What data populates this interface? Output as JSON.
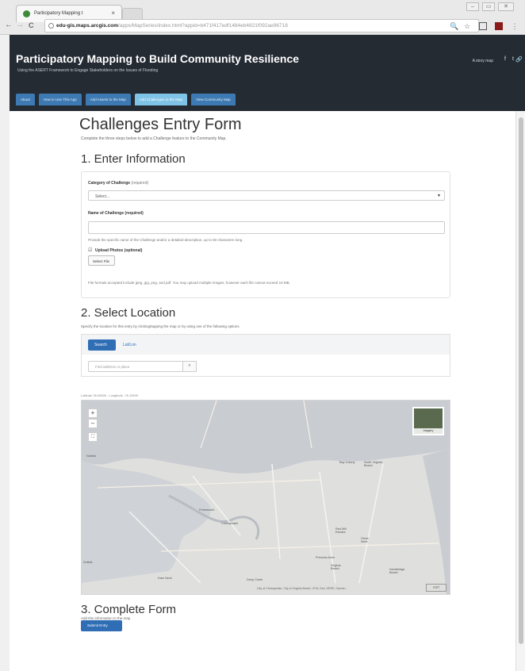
{
  "browser": {
    "tab_title": "Participatory Mapping t",
    "tab_close": "×",
    "back": "←",
    "forward": "→",
    "reload": "C",
    "url_domain": "edu-gis.maps.arcgis.com",
    "url_rest": "/apps/MapSeries/index.html?appid=b471f417edf1484eb4821f092ae96718",
    "win_min": "–",
    "win_max": "▭",
    "win_close": "✕",
    "ext_zoom": "🔍",
    "ext_star": "☆",
    "ext_menu": "⋮"
  },
  "header": {
    "title": "Participatory Mapping to Build Community Resilience",
    "subtitle": "Using the ASERT Framework to Engage Stakeholders on the Issues of Flooding",
    "story_map": "A story map",
    "social": [
      "f",
      "t",
      "🔗"
    ],
    "tabs": [
      {
        "label": "About"
      },
      {
        "label": "How to Use This App"
      },
      {
        "label": "Add Assets to the Map"
      },
      {
        "label": "Add Challenges to the Map"
      },
      {
        "label": "View Community Map"
      }
    ]
  },
  "form": {
    "heading": "Challenges Entry Form",
    "intro": "Complete the three steps below to add a Challenge feature to the Community Map.",
    "step1": "1. Enter Information",
    "category_label": "Category of Challenge",
    "category_req": "(required)",
    "category_value": "Select...",
    "name_label": "Name of Challenge (required)",
    "name_help": "Provide the specific name of the Challenge and/or a detailed description, up to 50 characters long.",
    "upload_label": "Upload Photos (optional)",
    "select_file": "Select File",
    "file_help": "File formats accepted include jpeg, jpg, png, and pdf. You may upload multiple images; however each file cannot exceed 10 MB.",
    "step2": "2. Select Location",
    "location_help": "Specify the location for this entry by clicking/tapping the map or by using one of the following options",
    "search_tab": "Search",
    "latlon_tab": "Lat/Lon",
    "address_placeholder": "Find address or place",
    "coords": "Latitude 36.90826 , Longitude -76.13539",
    "step3": "3. Complete Form",
    "step3_help": "Add this information to the map",
    "submit": "Submit Entry"
  },
  "map": {
    "zoom_in": "+",
    "zoom_out": "–",
    "fullscreen": "⛶",
    "basemap": "Imagery",
    "labels": [
      "Norfolk",
      "Bay Colony",
      "North Virginia Beach",
      "Portsmouth",
      "Chesapeake",
      "Red Mill Estates",
      "Great Neck",
      "Princess Anne",
      "Virginia Beach",
      "Dam Neck",
      "Deep Creek",
      "Sandbridge Beach",
      "Suffolk"
    ],
    "attribution": "City of Chesapeake, City of Virginia Beach, VITA, Esri, HERE, Garmin...",
    "esri": "esri"
  }
}
